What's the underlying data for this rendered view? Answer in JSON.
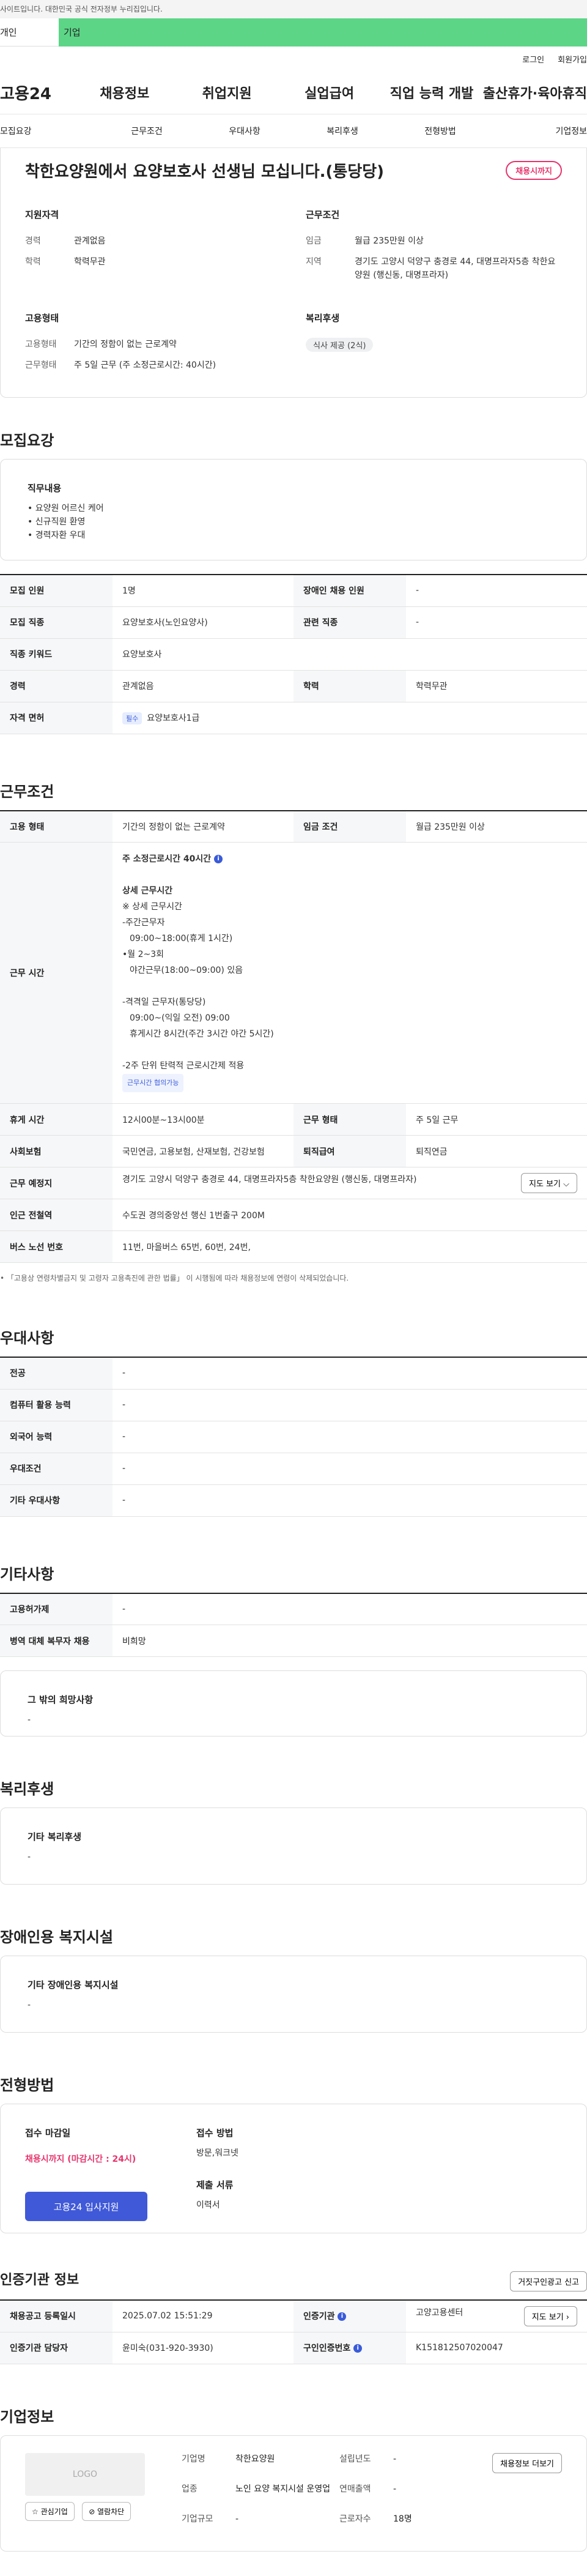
{
  "top": {
    "gov_notice": "사이트입니다. 대한민국 공식 전자정부 누리집입니다.",
    "tab_personal": "개인",
    "tab_corporate": "기업",
    "util_login": "로그인",
    "util_signup": "회원가입"
  },
  "nav": {
    "logo": "고용24",
    "items": [
      "채용정보",
      "취업지원",
      "실업급여",
      "직업 능력 개발",
      "출산휴가·육아휴직"
    ]
  },
  "subnav": [
    "모집요강",
    "근무조건",
    "우대사항",
    "복리후생",
    "전형방법",
    "기업정보"
  ],
  "header": {
    "title": "착한요양원에서 요양보호사 선생님 모십니다.(통당당)",
    "status": "채용시까지"
  },
  "summary": {
    "qual_h": "지원자격",
    "exp_k": "경력",
    "exp_v": "관계없음",
    "edu_k": "학력",
    "edu_v": "학력무관",
    "cond_h": "근무조건",
    "wage_k": "임금",
    "wage_v": "월급 235만원 이상",
    "region_k": "지역",
    "region_v": "경기도 고양시 덕양구 충경로 44, 대명프라자5층 착한요양원 (행신동, 대명프라자)",
    "emp_h": "고용형태",
    "emptype_k": "고용형태",
    "emptype_v": "기간의 정함이 없는 근로계약",
    "worktype_k": "근무형태",
    "worktype_v": "주 5일 근무 (주 소정근로시간: 40시간)",
    "welfare_h": "복리후생",
    "welfare_tag": "식사 제공 (2식)"
  },
  "recruit": {
    "title": "모집요강",
    "duty_h": "직무내용",
    "duty_lines": [
      "• 요양원 어르신 케어",
      "• 신규직원 환영",
      "• 경력자환 우대"
    ],
    "rows": [
      {
        "k1": "모집 인원",
        "v1": "1명",
        "k2": "장애인 채용 인원",
        "v2": "-"
      },
      {
        "k1": "모집 직종",
        "v1": "요양보호사(노인요양사)",
        "k2": "관련 직종",
        "v2": "-"
      },
      {
        "k1": "직종 키워드",
        "v1": "요양보호사"
      },
      {
        "k1": "경력",
        "v1": "관계없음",
        "k2": "학력",
        "v2": "학력무관"
      },
      {
        "k1": "자격 면허",
        "badge": "필수",
        "v1": "요양보호사1급"
      }
    ]
  },
  "conditions": {
    "title": "근무조건",
    "emp_k": "고용 형태",
    "emp_v": "기간의 정함이 없는 근로계약",
    "wage_k": "임금 조건",
    "wage_v": "월급 235만원 이상",
    "hours_k": "근무 시간",
    "hours_lines": [
      "주 소정근로시간 40시간",
      "",
      "상세 근무시간",
      "※ 상세 근무시간",
      "-주간근무자",
      "  09:00~18:00(휴게 1시간)",
      "•월 2~3회",
      "  야간근무(18:00~09:00) 있음",
      "",
      "-격격일 근무자(통당당)",
      "  09:00~(익일 오전) 09:00",
      "  휴게시간 8시간(주간 3시간 야간 5시간)",
      "",
      "-2주 단위 탄력적 근로시간제 적용"
    ],
    "hours_tag": "근무시간 협의가능",
    "break_k": "휴게 시간",
    "break_v": "12시00분~13시00분",
    "form_k": "근무 형태",
    "form_v": "주 5일 근무",
    "ins_k": "사회보험",
    "ins_v": "국민연금, 고용보험, 산재보험, 건강보험",
    "sev_k": "퇴직급여",
    "sev_v": "퇴직연금",
    "place_k": "근무 예정지",
    "place_v": "경기도 고양시 덕양구 충경로 44, 대명프라자5층 착한요양원 (행신동, 대명프라자)",
    "map_btn": "지도 보기 ⌵",
    "subway_k": "인근 전철역",
    "subway_v": "수도권 경의중앙선 행신 1번출구 200M",
    "bus_k": "버스 노선 번호",
    "bus_v": "11번, 마을버스 65번, 60번, 24번,",
    "note": "• 「고용상 연령차별금지 및 고령자 고용촉진에 관한 법률」 이 시행됨에 따라 채용정보에 연령이 삭제되었습니다."
  },
  "preference": {
    "title": "우대사항",
    "rows": [
      {
        "k": "전공",
        "v": "-"
      },
      {
        "k": "컴퓨터 활용 능력",
        "v": "-"
      },
      {
        "k": "외국어 능력",
        "v": "-"
      },
      {
        "k": "우대조건",
        "v": "-"
      },
      {
        "k": "기타 우대사항",
        "v": "-"
      }
    ]
  },
  "others": {
    "title": "기타사항",
    "rows": [
      {
        "k": "고용허가제",
        "v": "-"
      },
      {
        "k": "병역 대체 복무자 채용",
        "v": "비희망"
      }
    ],
    "hope_h": "그 밖의 희망사항",
    "hope_v": "-"
  },
  "welfare": {
    "title": "복리후생",
    "box_h": "기타 복리후생",
    "box_v": "-"
  },
  "disabled": {
    "title": "장애인용 복지시설",
    "box_h": "기타 장애인용 복지시설",
    "box_v": "-"
  },
  "screening": {
    "title": "전형방법",
    "deadline_h": "접수 마감일",
    "deadline_v": "채용시까지 (마감시간 : 24시)",
    "apply_btn": "고용24 입사지원",
    "method_h": "접수 방법",
    "method_v": "방문,워크넷",
    "docs_h": "제출 서류",
    "docs_v": "이력서"
  },
  "cert": {
    "title": "인증기관 정보",
    "report_btn": "거짓구인광고 신고",
    "reg_k": "채용공고 등록일시",
    "reg_v": "2025.07.02 15:51:29",
    "org_k": "인증기관",
    "org_v": "고양고용센터",
    "map_btn": "지도 보기 ›",
    "mgr_k": "인증기관 담당자",
    "mgr_v": "윤미숙(031-920-3930)",
    "id_k": "구인인증번호",
    "id_v": "K151812507020047"
  },
  "company": {
    "title": "기업정보",
    "logo": "LOGO",
    "fav_btn": "☆ 관심기업",
    "block_btn": "⊘ 열람차단",
    "name_k": "기업명",
    "name_v": "착한요양원",
    "year_k": "설립년도",
    "year_v": "-",
    "ind_k": "업종",
    "ind_v": "노인 요양 복지시설 운영업",
    "sales_k": "연매출액",
    "sales_v": "-",
    "emp_k": "근로자수",
    "emp_v": "18명",
    "size_k": "기업규모",
    "size_v": "-",
    "jobs_btn": "채용정보 더보기"
  }
}
